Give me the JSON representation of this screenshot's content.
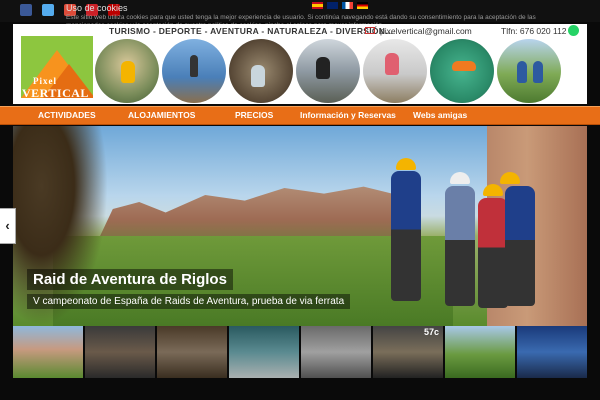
{
  "cookie": {
    "title": "Uso de cookies",
    "text": "Este sitio web utiliza cookies para que usted tenga la mejor experiencia de usuario. Si continúa navegando está dando su consentimiento para la aceptación de las mencionadas cookies y la aceptación de nuestra política de cookies, pinche el enlace para mayor información."
  },
  "social_icons": [
    {
      "name": "facebook-icon",
      "color": "#3b5998"
    },
    {
      "name": "twitter-icon",
      "color": "#55acee"
    },
    {
      "name": "google-plus-icon",
      "color": "#dd4b39"
    },
    {
      "name": "pinterest-icon",
      "color": "#cb2027"
    },
    {
      "name": "youtube-icon",
      "color": "#bb0000"
    }
  ],
  "header": {
    "logo_top": "Pixel",
    "logo_bottom": "VERTICAL",
    "tagline": "TURISMO - DEPORTE - AVENTURA - NATURALEZA - DIVERSIÓN...",
    "email": "pixelvertical@gmail.com",
    "phone": "Tlfn: 676 020 112"
  },
  "nav": {
    "items": [
      "ACTIVIDADES",
      "ALOJAMIENTOS",
      "PRECIOS",
      "Información y Reservas",
      "Webs amigas"
    ]
  },
  "hero": {
    "title": "Raid de Aventura de Riglos",
    "subtitle": "V campeonato de España de Raids de Aventura, prueba de via ferrata"
  },
  "thumbs": {
    "label": "57c"
  },
  "colors": {
    "nav_orange": "#e86e17",
    "logo_green": "#8dc63f",
    "logo_orange": "#f7931e"
  }
}
